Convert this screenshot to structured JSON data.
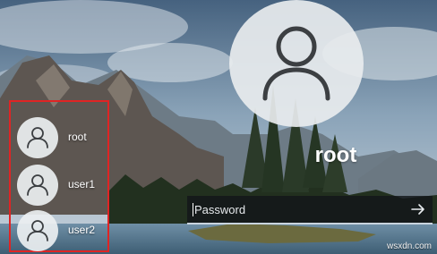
{
  "current_user": {
    "name": "root",
    "avatar_icon": "person-icon"
  },
  "password_field": {
    "placeholder": "Password",
    "value": "",
    "submit_icon": "arrow-right-icon"
  },
  "user_list": {
    "border_color": "#e02424",
    "items": [
      {
        "name": "root",
        "icon": "person-icon"
      },
      {
        "name": "user1",
        "icon": "person-icon"
      },
      {
        "name": "user2",
        "icon": "person-icon"
      }
    ]
  },
  "watermark": "wsxdn.com"
}
